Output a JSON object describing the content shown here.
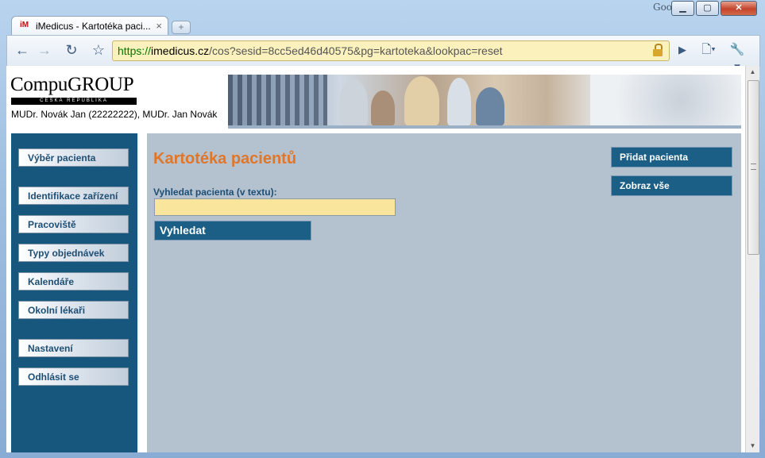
{
  "browser": {
    "google_label": "Google",
    "tab": {
      "title": "iMedicus - Kartotéka paci...",
      "favicon": "iM"
    },
    "url": {
      "scheme": "https://",
      "host": "imedicus.cz",
      "path": "/cos?sesid=8cc5ed46d40575&pg=kartoteka&lookpac=reset"
    },
    "icons": {
      "back": "back-arrow-icon",
      "forward": "forward-arrow-icon",
      "reload": "reload-icon",
      "star": "star-icon",
      "lock": "lock-icon",
      "go": "play-icon",
      "page": "page-menu-icon",
      "wrench": "wrench-icon"
    }
  },
  "header": {
    "logo_text": "CompuGROUP",
    "logo_subtext": "ČESKÁ REPUBLIKA",
    "doctor_info": "MUDr. Novák Jan (22222222), MUDr. Jan Novák"
  },
  "sidebar": {
    "items": [
      {
        "label": "Výběr pacienta"
      },
      {
        "label": "Identifikace zařízení"
      },
      {
        "label": "Pracoviště"
      },
      {
        "label": "Typy objednávek"
      },
      {
        "label": "Kalendáře"
      },
      {
        "label": "Okolní lékaři"
      },
      {
        "label": "Nastavení"
      },
      {
        "label": "Odhlásit se"
      }
    ]
  },
  "main": {
    "title": "Kartotéka pacientů",
    "search_label": "Vyhledat pacienta (v textu):",
    "search_value": "",
    "search_button": "Vyhledat",
    "add_patient_button": "Přidat pacienta",
    "show_all_button": "Zobraz vše"
  },
  "colors": {
    "sidebar_bg": "#17577d",
    "main_bg": "#b4c2d0",
    "title": "#e0762a",
    "button_bg": "#1b5f87",
    "input_bg": "#f9e59b"
  }
}
